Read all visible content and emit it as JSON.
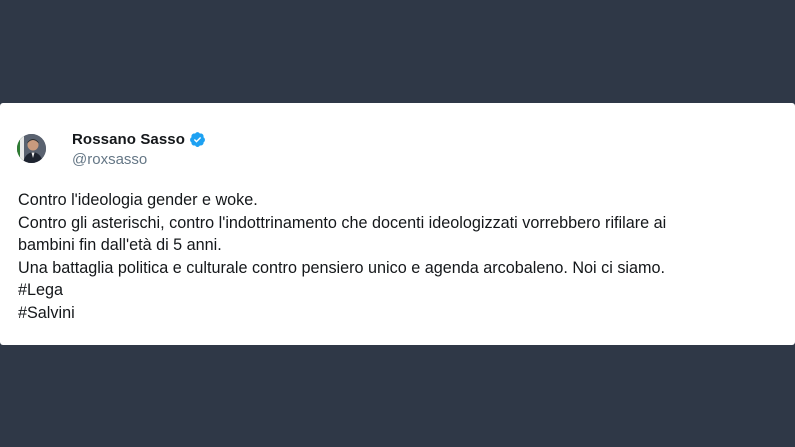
{
  "tweet": {
    "author": {
      "display_name": "Rossano Sasso",
      "handle": "@roxsasso",
      "verified": true,
      "verified_color": "#1da1f2"
    },
    "lines": [
      "Contro l'ideologia gender e woke.",
      "Contro gli asterischi, contro l'indottrinamento che docenti ideologizzati vorrebbero rifilare ai",
      "bambini fin dall'età di 5 anni.",
      "Una battaglia politica e culturale contro pensiero unico e agenda arcobaleno. Noi ci siamo.",
      "#Lega",
      "#Salvini"
    ]
  },
  "colors": {
    "background": "#2f3847",
    "card": "#ffffff",
    "text": "#14171a",
    "handle": "#657786"
  }
}
